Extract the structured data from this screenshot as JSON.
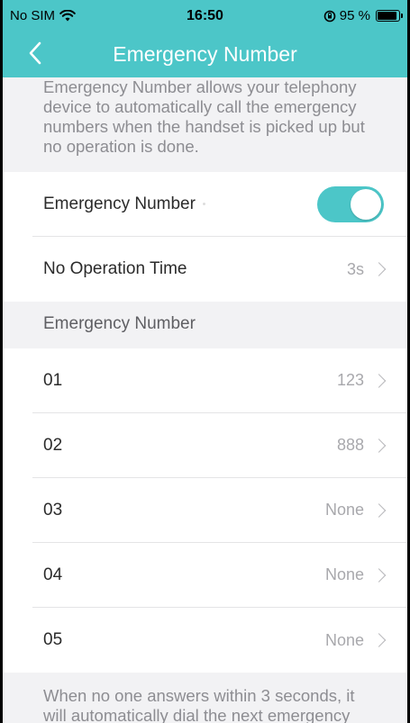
{
  "status_bar": {
    "carrier": "No SIM",
    "time": "16:50",
    "battery_text": "95 %"
  },
  "nav": {
    "title": "Emergency Number",
    "back_icon": "chevron-left-icon"
  },
  "description": "Emergency Number allows your telephony device to automatically call the emergency numbers when the handset is picked up but no operation is done.",
  "settings": {
    "emergency_toggle_label": "Emergency Number",
    "emergency_toggle_on": true,
    "no_op_label": "No Operation Time",
    "no_op_value": "3s"
  },
  "numbers_section": {
    "header": "Emergency Number",
    "items": [
      {
        "index": "01",
        "value": "123"
      },
      {
        "index": "02",
        "value": "888"
      },
      {
        "index": "03",
        "value": "None"
      },
      {
        "index": "04",
        "value": "None"
      },
      {
        "index": "05",
        "value": "None"
      }
    ]
  },
  "footer_note": "When no one answers within 3 seconds, it will automatically dial the next emergency",
  "colors": {
    "accent": "#4cc6c8",
    "background": "#f2f2f4"
  }
}
